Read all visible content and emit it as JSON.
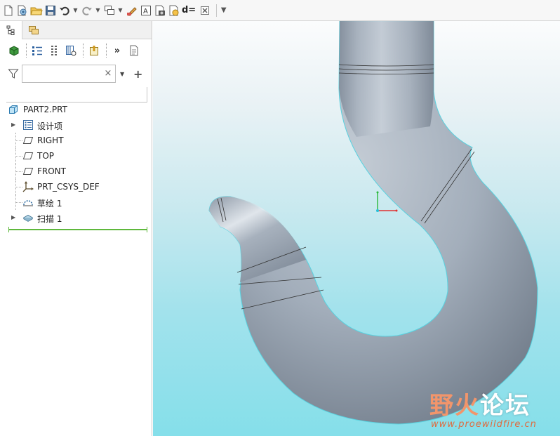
{
  "toolbar": {
    "items": [
      "new-icon",
      "regenerate-icon",
      "open-icon",
      "save-icon",
      "undo-icon",
      "redo-icon",
      "windows-icon",
      "edit-icon",
      "annotation-icon",
      "snapshot-icon",
      "rename-icon",
      "relations-icon",
      "close-window-icon",
      "customize-icon"
    ],
    "relations_label": "d="
  },
  "left_panel": {
    "tabs": [
      "model-tree-tab",
      "layer-tree-tab"
    ],
    "search": {
      "value": "",
      "placeholder": "",
      "clear": "×"
    },
    "add_label": "+",
    "tree": {
      "root": "PART2.PRT",
      "items": [
        {
          "label": "设计项",
          "icon": "design-items-icon",
          "expandable": true
        },
        {
          "label": "RIGHT",
          "icon": "datum-plane-icon",
          "expandable": false
        },
        {
          "label": "TOP",
          "icon": "datum-plane-icon",
          "expandable": false
        },
        {
          "label": "FRONT",
          "icon": "datum-plane-icon",
          "expandable": false
        },
        {
          "label": "PRT_CSYS_DEF",
          "icon": "csys-icon",
          "expandable": false
        },
        {
          "label": "草绘 1",
          "icon": "sketch-icon",
          "expandable": false
        },
        {
          "label": "扫描 1",
          "icon": "sweep-icon",
          "expandable": true
        }
      ]
    }
  },
  "viewport": {
    "model": "hook-sweep-model",
    "watermark": {
      "part1": "野火",
      "part2": "论坛",
      "url": "www.proewildfire.cn"
    }
  },
  "colors": {
    "model": "#a3aebb",
    "insert_line": "#5fb83c",
    "background_bottom": "#85dfea",
    "watermark": "#e06a3d"
  }
}
